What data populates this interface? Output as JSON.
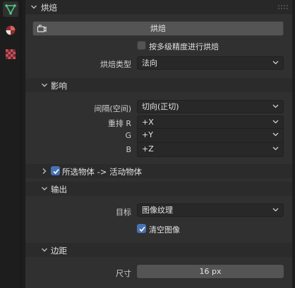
{
  "tabs": [
    {
      "icon": "triangle-vertex-icon",
      "color": "#4ec986",
      "active": true
    },
    {
      "icon": "material-sphere-icon",
      "color": "#e0605a",
      "active": false
    },
    {
      "icon": "checker-texture-icon",
      "color": "#d0505a",
      "active": false
    }
  ],
  "bake": {
    "section_title": "烘焙",
    "bake_button": "烘焙",
    "multires_label": "按多级精度进行烘焙",
    "multires_checked": false,
    "bake_type_label": "烘焙类型",
    "bake_type_value": "法向"
  },
  "influence": {
    "title": "影响",
    "space_label": "间隔(空间)",
    "space_value": "切向(正切)",
    "swizzle_r_label": "重排 R",
    "swizzle_r_value": "+X",
    "swizzle_g_label": "G",
    "swizzle_g_value": "+Y",
    "swizzle_b_label": "B",
    "swizzle_b_value": "+Z"
  },
  "selected_to_active": {
    "title": "所选物体 -> 活动物体",
    "checked": true
  },
  "output": {
    "title": "输出",
    "target_label": "目标",
    "target_value": "图像纹理",
    "clear_image_label": "清空图像",
    "clear_image_checked": true
  },
  "margin": {
    "title": "边距",
    "size_label": "尺寸",
    "size_value": "16 px"
  }
}
